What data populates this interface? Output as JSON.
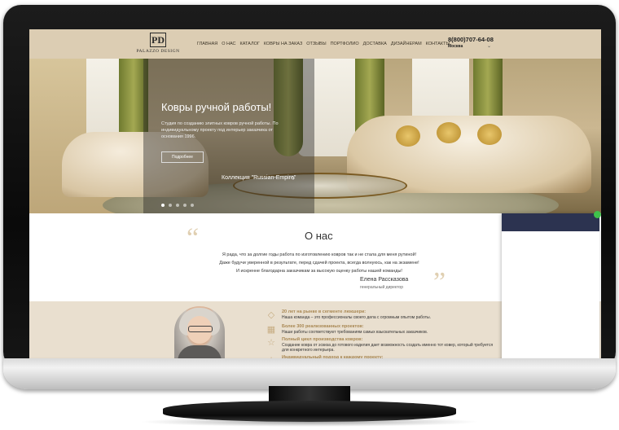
{
  "header": {
    "logo_text": "PALAZZO DESIGN",
    "logo_mark": "PD",
    "nav": [
      "ГЛАВНАЯ",
      "О НАС",
      "КАТАЛОГ",
      "КОВРЫ НА ЗАКАЗ",
      "ОТЗЫВЫ",
      "ПОРТФОЛИО",
      "ДОСТАВКА",
      "ДИЗАЙНЕРАМ",
      "КОНТАКТЫ"
    ],
    "phone": "8(800)707-64-08",
    "city": "Москва",
    "city_chevron": "chevron-down-icon"
  },
  "hero": {
    "title": "Ковры ручной работы!",
    "description": "Студия по созданию элитных ковров ручной работы. По индивидуальному проекту под интерьер заказчика от основания 1996.",
    "button_label": "Подробнее",
    "collection_label": "Коллекция \"Russian-Empire\"",
    "arrow_icon": "chevron-right-icon",
    "slide_count": 5,
    "active_slide": 1
  },
  "about": {
    "title": "О нас",
    "quote_open": "“",
    "quote_close": "”",
    "lines": [
      "Я рада, что за долгие годы работа по изготовлению ковров так и не стала для меня рутиной!",
      "Даже будучи уверенной в результате, перед сдачей проекта, всегда волнуюсь, как на экзамене!",
      "И искренне благодарна заказчикам за высокую оценку работы нашей команды!"
    ],
    "signer_name": "Елена Рассказова",
    "signer_role": "генеральный директор"
  },
  "features": [
    {
      "icon": "diamond-icon",
      "title": "20 лет на рынке в сегменте люкшери:",
      "desc": "Наша команда – это профессионалы своего дела с огромным опытом работы."
    },
    {
      "icon": "grid-icon",
      "title": "Более 300 реализованных проектов:",
      "desc": "Наши работы соответствуют требованиям самых взыскательных заказчиков."
    },
    {
      "icon": "star-icon",
      "title": "Полный цикл производства ковров:",
      "desc": "Создание ковра от эскиза до готового изделия дает возможность создать именно тот ковер, который требуется для конкретного интерьера."
    },
    {
      "icon": "star-icon",
      "title": "Индивидуальный подход к каждому проекту:",
      "desc": ""
    }
  ],
  "colors": {
    "header_bg": "#dccdb3",
    "accent_gold": "#a88752",
    "features_bg": "#e9dfcf",
    "widget_head": "#2c3350",
    "badge_green": "#3fc14b"
  }
}
